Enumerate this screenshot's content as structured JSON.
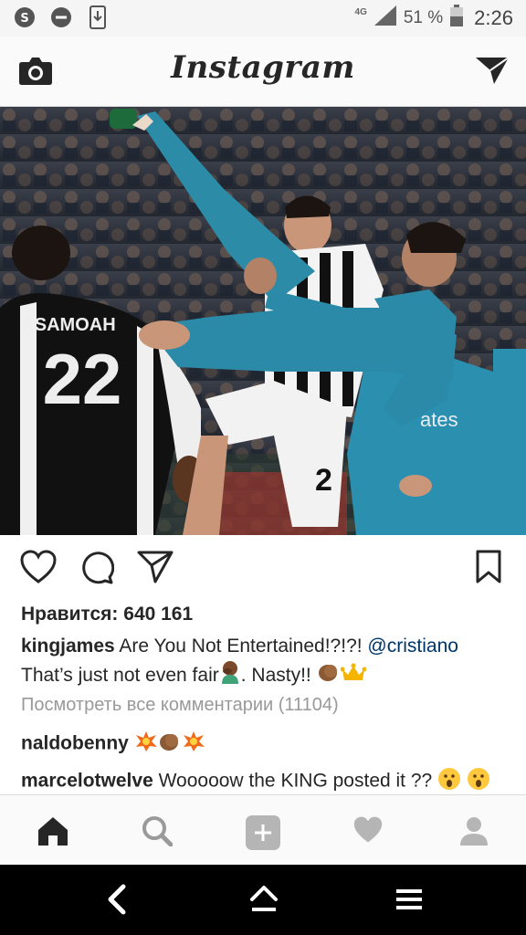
{
  "status": {
    "network": "4G",
    "battery": "51 %",
    "time": "2:26"
  },
  "header": {
    "title": "Instagram"
  },
  "post": {
    "jersey_name": "ASAMOAH",
    "jersey_number": "22",
    "sponsor_text": "ates",
    "player_number": "2",
    "likes": "Нравится: 640 161",
    "caption": {
      "username": "kingjames",
      "text1": " Are You Not Entertained!?!?! ",
      "mention": "@cristiano",
      "text2": "That’s just not even fair",
      "text3": ". Nasty!! "
    },
    "view_all": "Посмотреть все комментарии (11104)",
    "comments": [
      {
        "username": "naldobenny",
        "text": " "
      },
      {
        "username": "marcelotwelve",
        "text": " Wooooow the KING posted it ?? "
      }
    ]
  },
  "colors": {
    "accent": "#003569",
    "muted": "#999999",
    "text": "#262626"
  },
  "icons": [
    "camera-icon",
    "direct-icon",
    "heart-icon",
    "comment-icon",
    "share-icon",
    "bookmark-icon",
    "home-icon",
    "search-icon",
    "add-icon",
    "activity-icon",
    "profile-icon",
    "back-icon",
    "home-nav-icon",
    "recents-icon"
  ]
}
